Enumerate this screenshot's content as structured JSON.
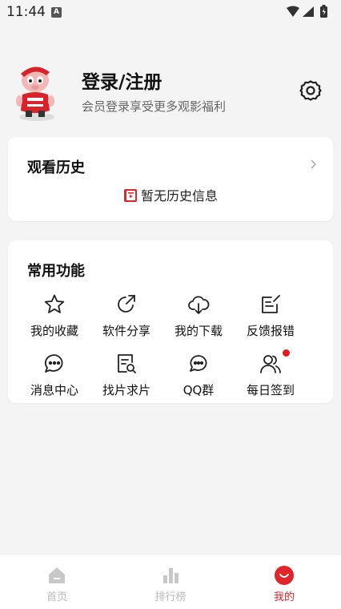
{
  "status": {
    "time": "11:44",
    "notification_badge": "A"
  },
  "profile": {
    "title": "登录/注册",
    "subtitle": "会员登录享受更多观影福利"
  },
  "history": {
    "title": "观看历史",
    "empty_text": "暂无历史信息"
  },
  "features": {
    "title": "常用功能",
    "items": [
      {
        "label": "我的收藏",
        "icon": "star-icon"
      },
      {
        "label": "软件分享",
        "icon": "share-icon"
      },
      {
        "label": "我的下载",
        "icon": "cloud-download-icon"
      },
      {
        "label": "反馈报错",
        "icon": "feedback-icon"
      },
      {
        "label": "消息中心",
        "icon": "message-icon"
      },
      {
        "label": "找片求片",
        "icon": "search-document-icon"
      },
      {
        "label": "QQ群",
        "icon": "chat-group-icon"
      },
      {
        "label": "每日签到",
        "icon": "users-icon"
      }
    ]
  },
  "tabs": [
    {
      "label": "首页",
      "icon": "home-icon"
    },
    {
      "label": "排行榜",
      "icon": "bar-chart-icon"
    },
    {
      "label": "我的",
      "icon": "smile-icon",
      "active": true
    }
  ],
  "colors": {
    "accent": "#e0252b",
    "background": "#f4f4f4",
    "card": "#ffffff"
  }
}
